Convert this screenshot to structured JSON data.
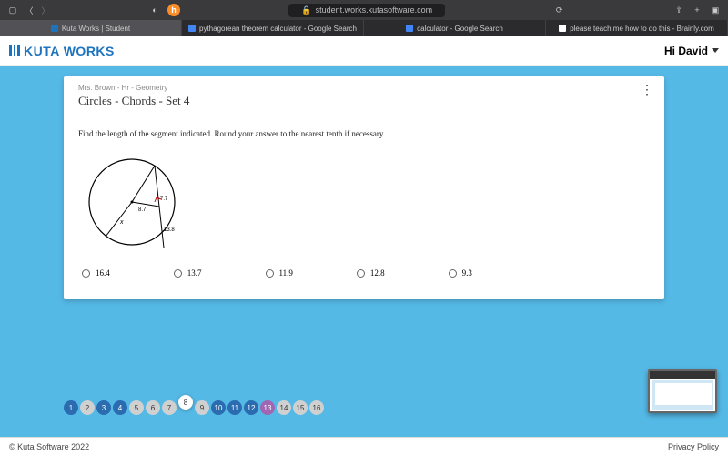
{
  "browser": {
    "url": "student.works.kutasoftware.com",
    "tabs": [
      {
        "label": "Kuta Works | Student",
        "active": true,
        "faviconColor": "#1e73be"
      },
      {
        "label": "pythagorean theorem calculator - Google Search",
        "active": false,
        "faviconColor": "#4285f4"
      },
      {
        "label": "calculator - Google Search",
        "active": false,
        "faviconColor": "#4285f4"
      },
      {
        "label": "please teach me how to do this - Brainly.com",
        "active": false,
        "faviconColor": "#ffffff"
      }
    ]
  },
  "app": {
    "brand": "KUTA WORKS",
    "greeting": "Hi David",
    "crumb": "Mrs. Brown - Hr - Geometry",
    "title": "Circles - Chords - Set 4",
    "question": "Find the length of the segment indicated.  Round your answer to the nearest tenth if necessary.",
    "diagram_labels": {
      "r": "8.7",
      "half": "7.7",
      "chord": "13.8",
      "unknown": "x"
    },
    "answers": [
      "16.4",
      "13.7",
      "11.9",
      "12.8",
      "9.3"
    ],
    "pager": [
      {
        "n": "1",
        "state": "done"
      },
      {
        "n": "2",
        "state": ""
      },
      {
        "n": "3",
        "state": "done"
      },
      {
        "n": "4",
        "state": "done"
      },
      {
        "n": "5",
        "state": ""
      },
      {
        "n": "6",
        "state": ""
      },
      {
        "n": "7",
        "state": ""
      },
      {
        "n": "8",
        "state": "pop"
      },
      {
        "n": "9",
        "state": ""
      },
      {
        "n": "10",
        "state": "done"
      },
      {
        "n": "11",
        "state": "done"
      },
      {
        "n": "12",
        "state": "done"
      },
      {
        "n": "13",
        "state": "alt"
      },
      {
        "n": "14",
        "state": ""
      },
      {
        "n": "15",
        "state": ""
      },
      {
        "n": "16",
        "state": ""
      }
    ],
    "copyright": "© Kuta Software 2022",
    "privacy": "Privacy Policy"
  }
}
